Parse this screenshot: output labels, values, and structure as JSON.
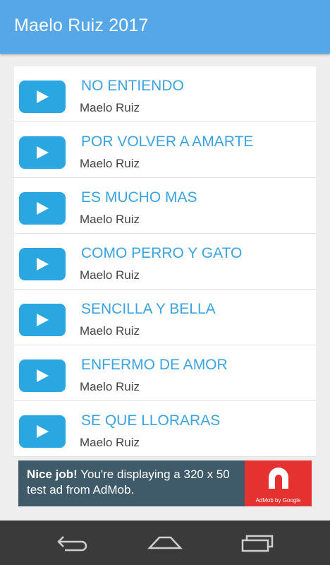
{
  "app_bar": {
    "title": "Maelo Ruiz 2017",
    "color": "#56a7e8"
  },
  "songs": [
    {
      "title": "NO ENTIENDO",
      "artist": "Maelo Ruiz"
    },
    {
      "title": "POR VOLVER A AMARTE",
      "artist": "Maelo Ruiz"
    },
    {
      "title": "ES MUCHO MAS",
      "artist": "Maelo Ruiz"
    },
    {
      "title": "COMO PERRO Y GATO",
      "artist": "Maelo Ruiz"
    },
    {
      "title": "SENCILLA Y BELLA",
      "artist": "Maelo Ruiz"
    },
    {
      "title": "ENFERMO DE AMOR",
      "artist": "Maelo Ruiz"
    },
    {
      "title": "SE QUE LLORARAS",
      "artist": "Maelo Ruiz"
    }
  ],
  "ad": {
    "headline": "Nice job!",
    "body": " You're displaying a 320 x 50 test ad from AdMob.",
    "brand": "AdMob by Google",
    "icon": "admob-logo-icon"
  },
  "nav": {
    "back_icon": "back-icon",
    "home_icon": "home-icon",
    "recents_icon": "recents-icon"
  }
}
